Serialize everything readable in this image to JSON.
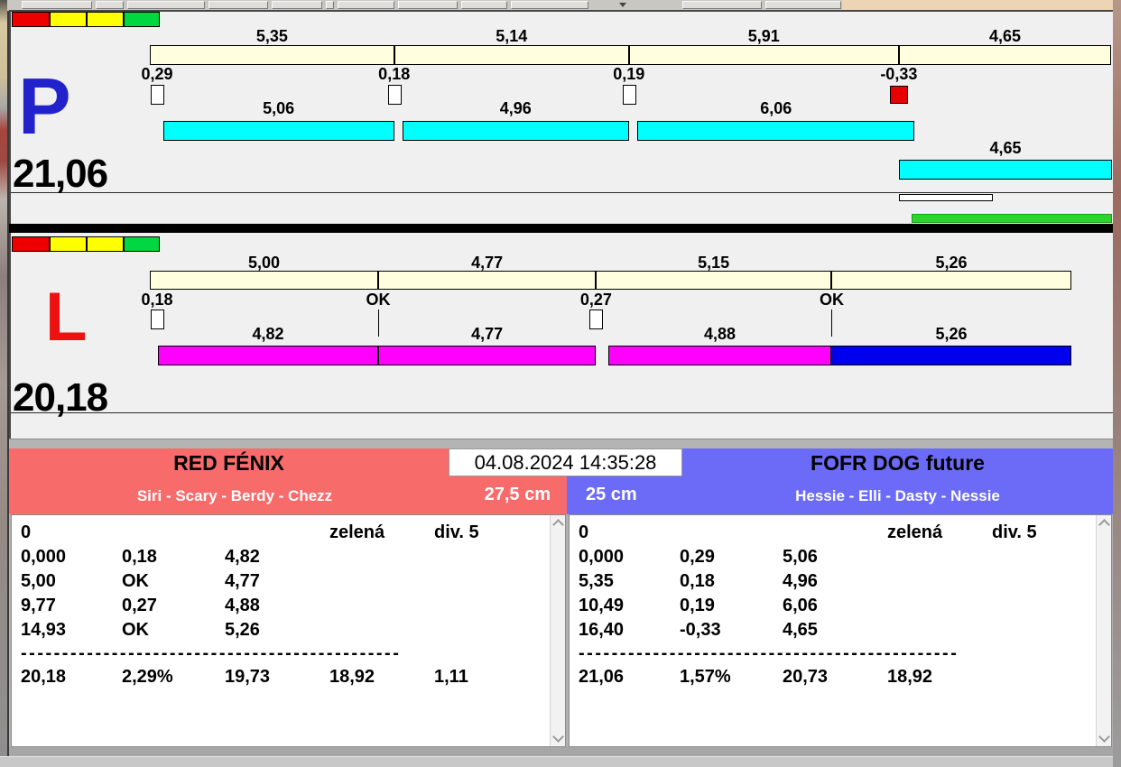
{
  "legend_colors": [
    "#ee0000",
    "#ffff00",
    "#ffff00",
    "#00d741"
  ],
  "panels": [
    {
      "letter": "P",
      "letter_color": "#2222cc",
      "total_label": "21,06",
      "plan_segments": [
        {
          "label": "5,35",
          "value": 5.35
        },
        {
          "label": "5,14",
          "value": 5.14
        },
        {
          "label": "5,91",
          "value": 5.91
        },
        {
          "label": "4,65",
          "value": 4.65
        }
      ],
      "checkpoints": [
        {
          "label": "0,29",
          "pos": 0,
          "marker": "box"
        },
        {
          "label": "0,18",
          "pos": 5.35,
          "marker": "box"
        },
        {
          "label": "0,19",
          "pos": 10.49,
          "marker": "box"
        },
        {
          "label": "-0,33",
          "pos": 16.4,
          "marker": "box-red"
        }
      ],
      "run_segments": [
        {
          "label": "5,06",
          "start": 0.29,
          "value": 5.06,
          "color": "#00ffff",
          "row": 1
        },
        {
          "label": "4,96",
          "start": 5.53,
          "value": 4.96,
          "color": "#00ffff",
          "row": 1
        },
        {
          "label": "6,06",
          "start": 10.68,
          "value": 6.06,
          "color": "#00ffff",
          "row": 1
        },
        {
          "label": "4,65",
          "start": 16.41,
          "value": 4.65,
          "color": "#00ffff",
          "row": 2
        }
      ],
      "extra_bars": [
        {
          "band": "white",
          "color": "#ffffff",
          "start": 16.41,
          "length": 2.05
        },
        {
          "band": "green",
          "color": "#2bd52b",
          "start": 16.68,
          "length": 4.38
        }
      ]
    },
    {
      "letter": "L",
      "letter_color": "#ee1111",
      "total_label": "20,18",
      "plan_segments": [
        {
          "label": "5,00",
          "value": 5.0
        },
        {
          "label": "4,77",
          "value": 4.77
        },
        {
          "label": "5,15",
          "value": 5.15
        },
        {
          "label": "5,26",
          "value": 5.26
        }
      ],
      "checkpoints": [
        {
          "label": "0,18",
          "pos": 0,
          "marker": "box"
        },
        {
          "label": "OK",
          "pos": 5.0,
          "marker": "tick"
        },
        {
          "label": "0,27",
          "pos": 9.77,
          "marker": "box"
        },
        {
          "label": "OK",
          "pos": 14.93,
          "marker": "tick"
        }
      ],
      "run_segments": [
        {
          "label": "4,82",
          "start": 0.18,
          "value": 4.82,
          "color": "#ff00ff",
          "row": 1
        },
        {
          "label": "4,77",
          "start": 5.0,
          "value": 4.77,
          "color": "#ff00ff",
          "row": 1
        },
        {
          "label": "4,88",
          "start": 10.04,
          "value": 4.88,
          "color": "#ff00ff",
          "row": 1
        },
        {
          "label": "5,26",
          "start": 14.92,
          "value": 5.26,
          "color": "#0000ee",
          "row": 1
        }
      ],
      "extra_bars": []
    }
  ],
  "footer": {
    "datetime": "04.08.2024 14:35:28",
    "teams": [
      {
        "name": "RED FÉNIX",
        "dogs": "Siri - Scary - Berdy - Chezz",
        "height": "27,5 cm",
        "accent": "#f76b6b",
        "sheet": {
          "header_row": [
            "0",
            "",
            "",
            "zelená",
            "div. 5"
          ],
          "rows": [
            [
              "0,000",
              "0,18",
              "4,82"
            ],
            [
              "5,00",
              "OK",
              "4,77"
            ],
            [
              "9,77",
              "0,27",
              "4,88"
            ],
            [
              "14,93",
              "OK",
              "5,26"
            ]
          ],
          "separator": "----------------------------------------------",
          "summary": [
            "20,18",
            "2,29%",
            "19,73",
            "18,92",
            "1,11"
          ]
        }
      },
      {
        "name": "FOFR DOG future",
        "dogs": "Hessie - Elli - Dasty - Nessie",
        "height": "25 cm",
        "accent": "#6b6bf7",
        "sheet": {
          "header_row": [
            "0",
            "",
            "",
            "zelená",
            "div. 5"
          ],
          "rows": [
            [
              "0,000",
              "0,29",
              "5,06"
            ],
            [
              "5,35",
              "0,18",
              "4,96"
            ],
            [
              "10,49",
              "0,19",
              "6,06"
            ],
            [
              "16,40",
              "-0,33",
              "4,65"
            ]
          ],
          "separator": "----------------------------------------------",
          "summary": [
            "21,06",
            "1,57%",
            "20,73",
            "18,92"
          ]
        }
      }
    ]
  }
}
